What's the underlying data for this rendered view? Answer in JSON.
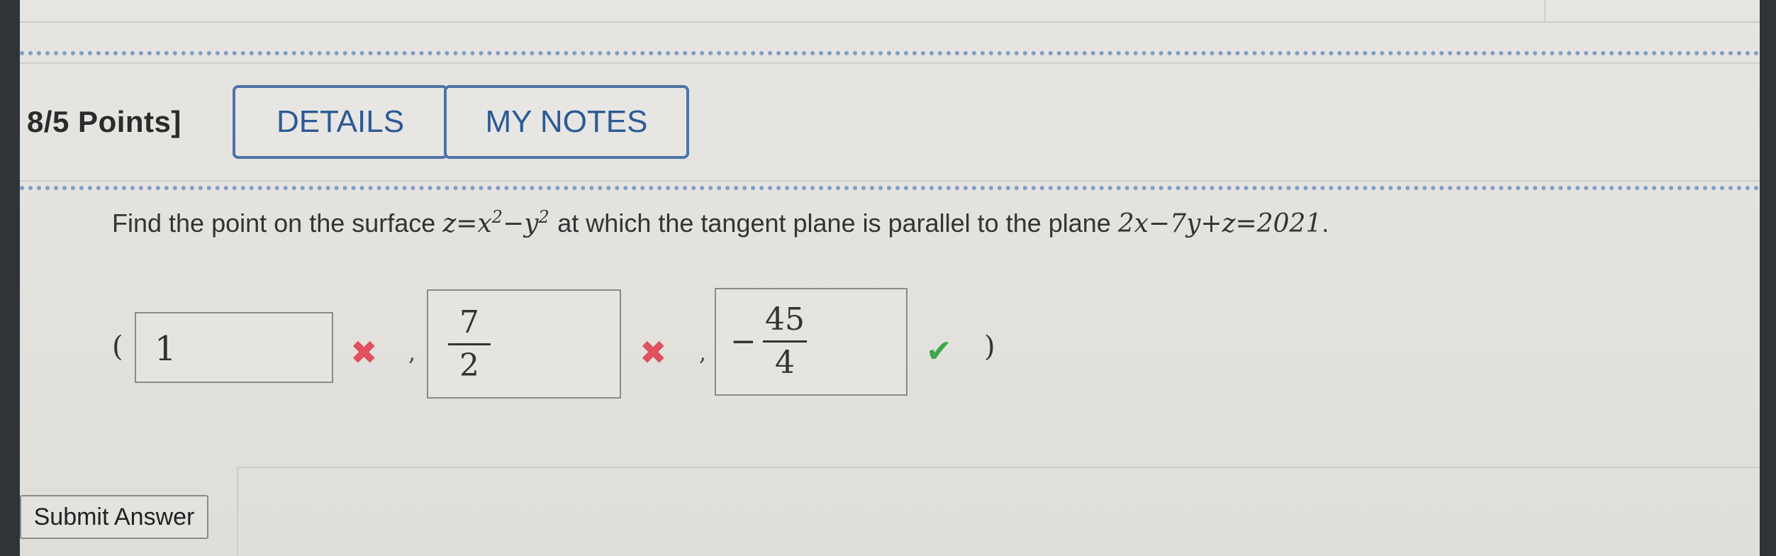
{
  "points_label": "8/5 Points]",
  "tabs": {
    "details": "DETAILS",
    "my_notes": "MY NOTES"
  },
  "question": {
    "intro": "Find the point on the surface",
    "surface_lhs": "z=x",
    "surface_exp1": "2",
    "surface_mid": "−y",
    "surface_exp2": "2",
    "middle": "at which the tangent plane is parallel to the plane",
    "plane_eq": "2x−7y+z=2021",
    "period": "."
  },
  "answer": {
    "open_paren": "(",
    "close_paren": ")",
    "comma": ",",
    "x_value": "1",
    "y_numerator": "7",
    "y_denominator": "2",
    "z_sign": "−",
    "z_numerator": "45",
    "z_denominator": "4",
    "x_status": "incorrect",
    "y_status": "incorrect",
    "z_status": "correct",
    "status_colors": {
      "incorrect": "#e0505e",
      "correct": "#3fa84a"
    }
  },
  "submit_label": "Submit Answer",
  "icons": {
    "incorrect": "cross-icon",
    "correct": "checkmark-icon"
  },
  "colors": {
    "accent": "#2d5a96",
    "dotted_rule": "#7f9ec4"
  }
}
